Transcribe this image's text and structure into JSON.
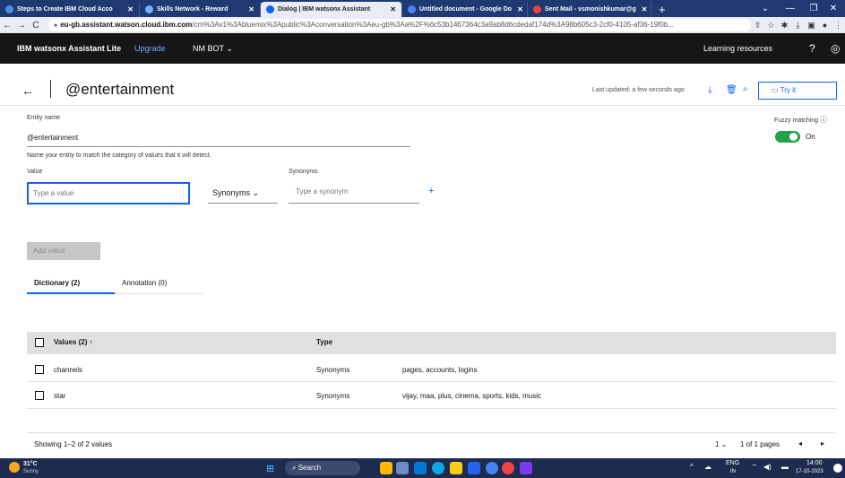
{
  "browser": {
    "tabs": [
      {
        "title": "Steps to Create IBM Cloud Acco",
        "color": "#4a90e2"
      },
      {
        "title": "Skills Network - Reward",
        "color": "#6fb3ff"
      },
      {
        "title": "Dialog | IBM watsonx Assistant",
        "color": "#0f62fe",
        "active": true
      },
      {
        "title": "Untitled document - Google Do",
        "color": "#4285f4"
      },
      {
        "title": "Sent Mail - vsmonishkumar@g",
        "color": "#ea4335"
      }
    ],
    "new_tab": "+",
    "url_domain": "eu-gb.assistant.watson.cloud.ibm.com",
    "url_path": "/crn%3Av1%3Abluemix%3Apublic%3Aconversation%3Aeu-gb%3Aa%2F%6c53b1467364c3a9ab8d6cdedaf174d%3A98b605c3-2cf0-4105-af36-19f0b..."
  },
  "header": {
    "brand": "IBM watsonx Assistant Lite",
    "upgrade": "Upgrade",
    "bot_menu": "NM BOT",
    "learning": "Learning resources"
  },
  "page": {
    "title": "@entertainment",
    "last_updated": "Last updated: a few seconds ago",
    "try_it": "Try it",
    "entity_name_label": "Entity name",
    "entity_name_value": "@entertainment",
    "entity_help": "Name your entity to match the category of values that it will detect.",
    "fuzzy_label": "Fuzzy matching",
    "fuzzy_state": "On",
    "value_label": "Value",
    "value_placeholder": "Type a value",
    "synonyms_dropdown": "Synonyms",
    "synonyms_label": "Synonyms",
    "synonym_placeholder": "Type a synonym",
    "add_value": "Add value",
    "tabs": [
      {
        "label": "Dictionary (2)",
        "active": true
      },
      {
        "label": "Annotation (0)",
        "active": false
      }
    ],
    "table": {
      "col_values": "Values (2)",
      "col_type": "Type",
      "rows": [
        {
          "value": "channels",
          "type": "Synonyms",
          "synonyms": "pages, accounts, logins"
        },
        {
          "value": "star",
          "type": "Synonyms",
          "synonyms": "vijay, maa, plus, cinema, sports, kids, music"
        }
      ]
    },
    "showing": "Showing 1–2 of 2 values",
    "per_page": "1",
    "pages": "1 of 1 pages"
  },
  "taskbar": {
    "weather_temp": "31°C",
    "weather_desc": "Sunny",
    "search": "Search",
    "lang": "ENG",
    "lang_sub": "IN",
    "time": "14:00",
    "date": "17-10-2023"
  }
}
